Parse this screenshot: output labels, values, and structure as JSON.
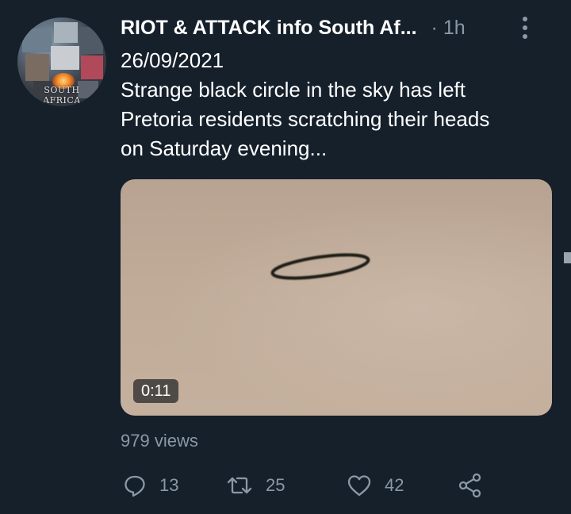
{
  "tweet": {
    "author_name": "RIOT & ATTACK info South Af...",
    "time": "· 1h",
    "avatar_caption": "SOUTH AFRICA",
    "text_lines": [
      "26/09/2021",
      "Strange black circle in the sky has left",
      "Pretoria residents scratching their heads",
      "on Saturday evening..."
    ],
    "media": {
      "duration": "0:11"
    },
    "views": "979 views",
    "actions": {
      "reply": {
        "icon": "reply-icon",
        "count": "13"
      },
      "retweet": {
        "icon": "retweet-icon",
        "count": "25"
      },
      "like": {
        "icon": "heart-icon",
        "count": "42"
      },
      "share": {
        "icon": "share-icon"
      }
    }
  },
  "colors": {
    "background": "#15202b",
    "text_primary": "#ffffff",
    "text_secondary": "#8b98a5"
  }
}
